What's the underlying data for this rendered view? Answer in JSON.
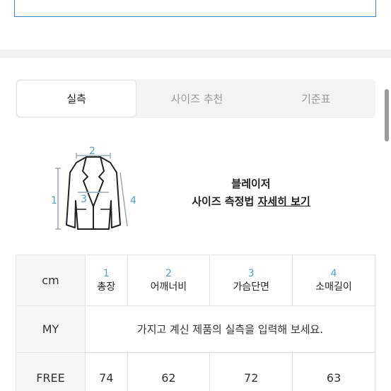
{
  "tabs": [
    {
      "label": "실측",
      "active": true
    },
    {
      "label": "사이즈 추천",
      "active": false
    },
    {
      "label": "기준표",
      "active": false
    }
  ],
  "illustration": {
    "markers": [
      "1",
      "2",
      "3",
      "4"
    ],
    "marker_color": "#4ea0d4"
  },
  "info": {
    "title": "블레이저",
    "subtitle_prefix": "사이즈 측정법",
    "subtitle_link": "자세히 보기"
  },
  "table": {
    "unit_label": "cm",
    "columns": [
      {
        "num": "1",
        "name": "총장"
      },
      {
        "num": "2",
        "name": "어깨너비"
      },
      {
        "num": "3",
        "name": "가슴단면"
      },
      {
        "num": "4",
        "name": "소매길이"
      }
    ],
    "my_row": {
      "label": "MY",
      "message": "가지고 계신 제품의 실측을 입력해 보세요."
    },
    "free_row": {
      "label": "FREE",
      "values": [
        "74",
        "62",
        "72",
        "63"
      ]
    }
  },
  "colors": {
    "accent": "#4ea0d4",
    "border_blue": "#3a82c9"
  }
}
